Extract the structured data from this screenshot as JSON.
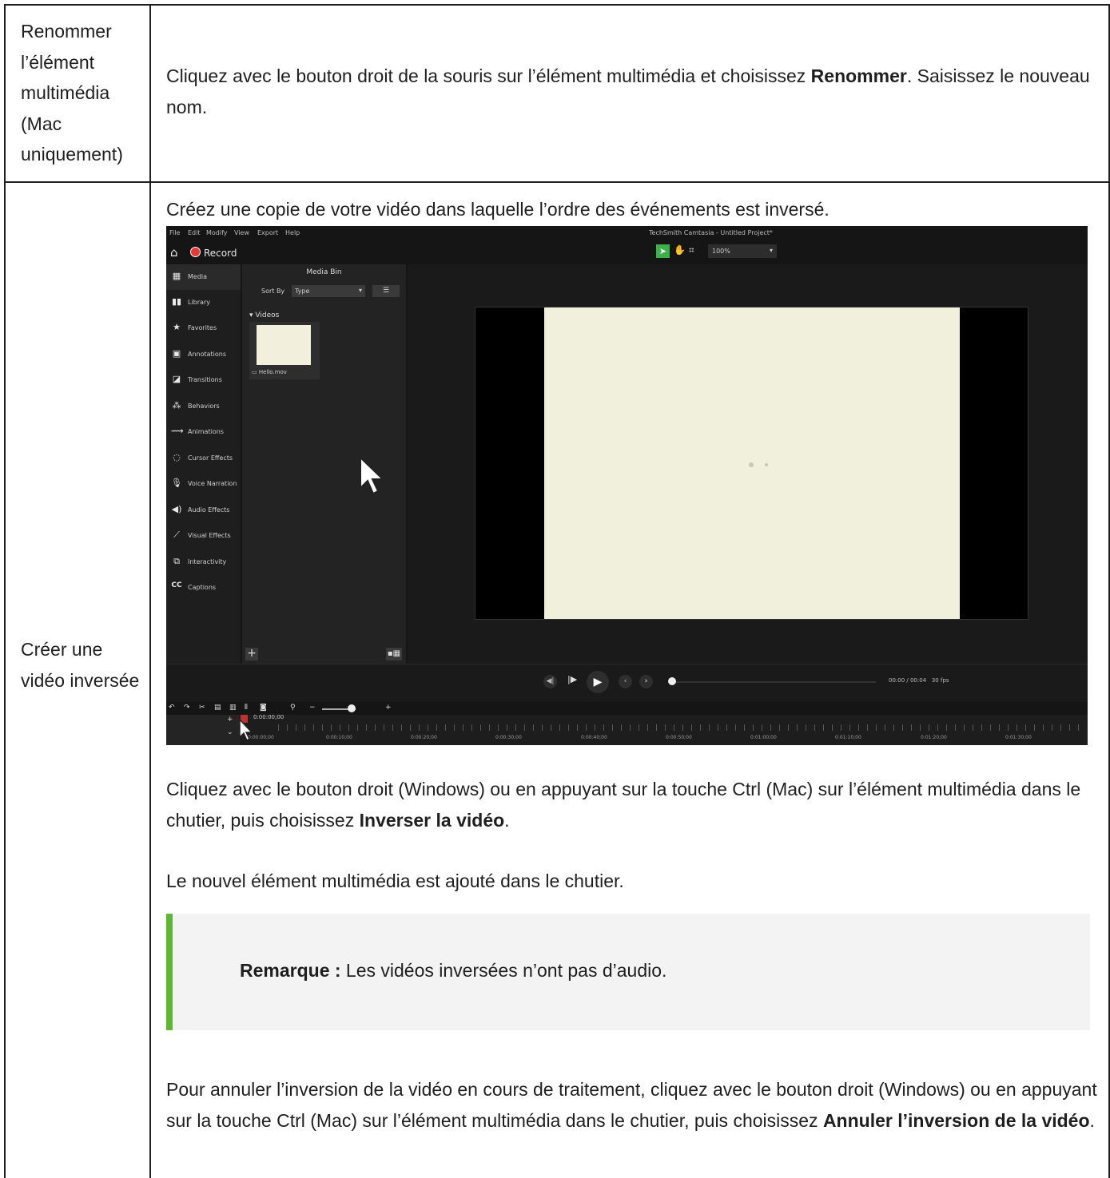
{
  "rows": [
    {
      "label": "Renommer l’élément multimédia (Mac uniquement)",
      "text_before": "Cliquez avec le bouton droit de la souris sur l’élément multimédia et choisissez ",
      "bold": "Renommer",
      "text_after": ". Saisissez le nouveau nom."
    },
    {
      "label": "Créer une vidéo inversée",
      "intro": "Créez une copie de votre vidéo dans laquelle l’ordre des événements est inversé.",
      "step_before": "Cliquez avec le bouton droit (Windows) ou en appuyant sur la touche Ctrl (Mac) sur l’élément multimédia dans le chutier, puis choisissez ",
      "step_bold": "Inverser la vidéo",
      "step_after": ".",
      "result": "Le nouvel élément multimédia est ajouté dans le chutier.",
      "note_bold": "Remarque :",
      "note_text": " Les vidéos inversées n’ont pas d’audio.",
      "cancel_before": "Pour annuler l’inversion de la vidéo en cours de traitement, cliquez avec le bouton droit (Windows) ou en appuyant sur la touche Ctrl (Mac) sur l’élément multimédia dans le chutier, puis choisissez ",
      "cancel_bold": "Annuler l’inversion de la vidéo",
      "cancel_after": "."
    }
  ],
  "screenshot": {
    "menu": [
      "File",
      "Edit",
      "Modify",
      "View",
      "Export",
      "Help"
    ],
    "window_title": "TechSmith Camtasia - Untitled Project*",
    "record_label": "Record",
    "zoom_value": "100%",
    "sidebar": [
      {
        "label": "Media",
        "icon": "film-icon"
      },
      {
        "label": "Library",
        "icon": "library-icon"
      },
      {
        "label": "Favorites",
        "icon": "star-icon"
      },
      {
        "label": "Annotations",
        "icon": "annotation-icon"
      },
      {
        "label": "Transitions",
        "icon": "transition-icon"
      },
      {
        "label": "Behaviors",
        "icon": "behavior-icon"
      },
      {
        "label": "Animations",
        "icon": "animation-icon"
      },
      {
        "label": "Cursor Effects",
        "icon": "cursor-effects-icon"
      },
      {
        "label": "Voice Narration",
        "icon": "microphone-icon"
      },
      {
        "label": "Audio Effects",
        "icon": "speaker-icon"
      },
      {
        "label": "Visual Effects",
        "icon": "wand-icon"
      },
      {
        "label": "Interactivity",
        "icon": "interactivity-icon"
      },
      {
        "label": "Captions",
        "icon": "captions-icon"
      }
    ],
    "media_bin": {
      "title": "Media Bin",
      "sort_label": "Sort By",
      "sort_value": "Type",
      "group": "Videos",
      "item": "Hello.mov"
    },
    "playback": {
      "time": "00:00 / 00:04",
      "fps": "30 fps"
    },
    "playhead_time": "0:00:00;00",
    "ruler_ticks": [
      "0:00:00;00",
      "0:00:10;00",
      "0:00:20;00",
      "0:00:30;00",
      "0:00:40;00",
      "0:00:50;00",
      "0:01:00;00",
      "0:01:10;00",
      "0:01:20;00",
      "0:01:30;00"
    ]
  }
}
